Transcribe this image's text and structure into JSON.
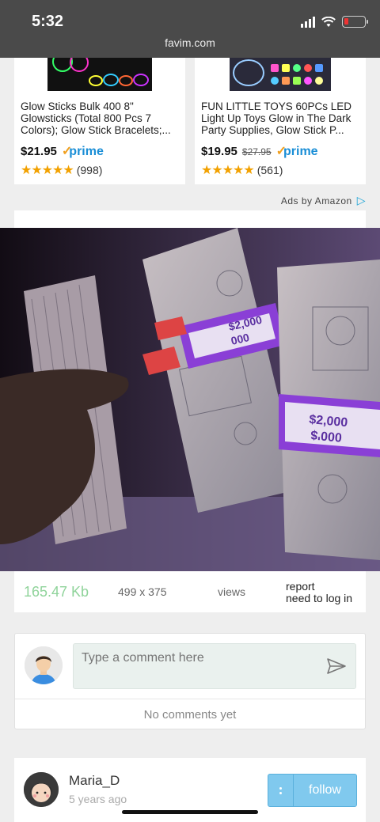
{
  "status": {
    "time": "5:32",
    "url": "favim.com"
  },
  "ads": [
    {
      "title": "Glow Sticks Bulk 400 8\" Glowsticks (Total 800 Pcs 7 Colors); Glow Stick Bracelets;...",
      "price": "$21.95",
      "old_price": "",
      "prime": "prime",
      "stars": "★★★★★",
      "reviews": "(998)"
    },
    {
      "title": "FUN LITTLE TOYS 60PCs LED Light Up Toys Glow in The Dark Party Supplies, Glow Stick P...",
      "price": "$19.95",
      "old_price": "$27.95",
      "prime": "prime",
      "stars": "★★★★★",
      "reviews": "(561)"
    }
  ],
  "ads_by": "Ads by Amazon",
  "photo_text": {
    "band_top": "$2,000",
    "band_top_2": "000",
    "band_right": "$2,000",
    "band_right_2": "000'$"
  },
  "meta": {
    "filesize": "165.47 Kb",
    "dims": "499 x 375",
    "views": "views",
    "report": "report",
    "login": "need to log in"
  },
  "comment": {
    "placeholder": "Type a comment here",
    "empty": "No comments yet"
  },
  "user": {
    "name": "Maria_D",
    "ago": "5 years ago",
    "follow": "follow"
  },
  "colors": {
    "accent": "#80c9ee",
    "filesize": "#8fd39a",
    "band": "#8a3fd6"
  }
}
